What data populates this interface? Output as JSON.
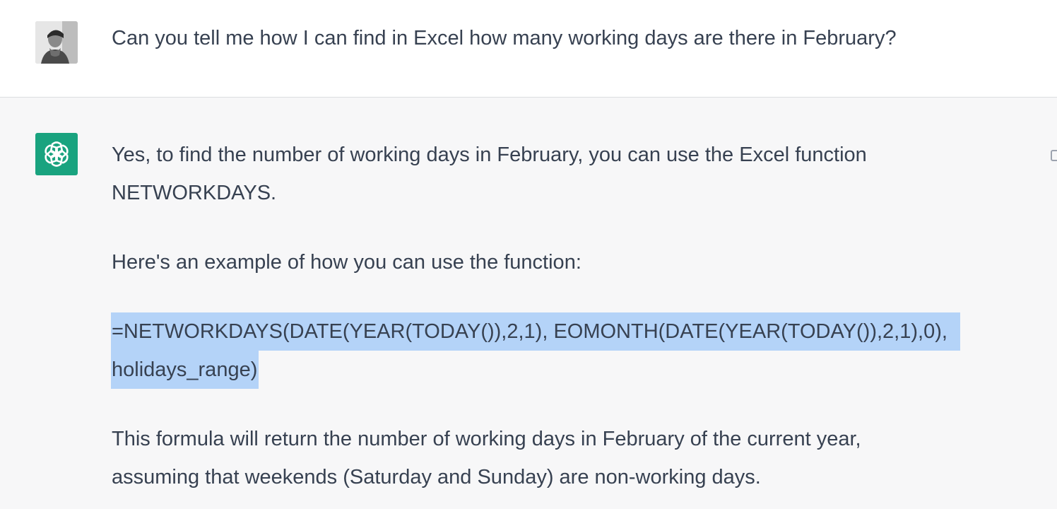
{
  "user_message": {
    "text": "Can you tell me how I can find in Excel how many working days are there in February?",
    "avatar_icon": "user-photo-avatar"
  },
  "assistant_message": {
    "avatar_icon": "openai-logo-icon",
    "avatar_color": "#19a37f",
    "paragraph1_line1": "Yes, to find the number of working days in February, you can use the Excel function",
    "paragraph1_line2": "NETWORKDAYS.",
    "paragraph2": "Here's an example of how you can use the function:",
    "formula_line1": "=NETWORKDAYS(DATE(YEAR(TODAY()),2,1), EOMONTH(DATE(YEAR(TODAY()),2,1),0),",
    "formula_line2": "holidays_range)",
    "paragraph4_line1": "This formula will return the number of working days in February of the current year,",
    "paragraph4_line2": "assuming that weekends (Saturday and Sunday) are non-working days.",
    "selection_color": "#b4d3f8"
  },
  "colors": {
    "user_bg": "#ffffff",
    "assistant_bg": "#f7f7f8",
    "text": "#374151"
  }
}
